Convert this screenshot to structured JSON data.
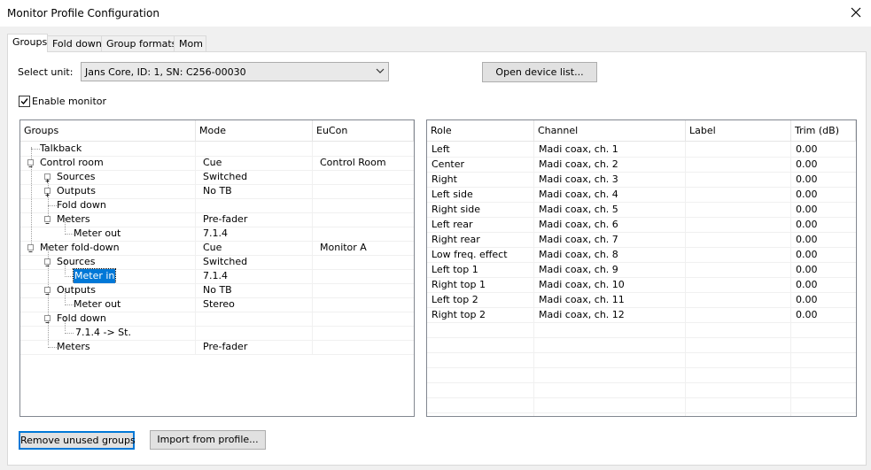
{
  "window": {
    "title": "Monitor Profile Configuration"
  },
  "tabs": [
    {
      "label": "Groups",
      "active": true
    },
    {
      "label": "Fold down",
      "active": false
    },
    {
      "label": "Group formats",
      "active": false
    },
    {
      "label": "Mom",
      "active": false
    }
  ],
  "select_unit": {
    "label": "Select unit:",
    "value": "Jans Core, ID: 1, SN: C256-00030"
  },
  "open_device_list": "Open device list...",
  "enable_monitor": {
    "label": "Enable monitor",
    "checked": true
  },
  "groups_table": {
    "headers": [
      "Groups",
      "Mode",
      "EuCon"
    ],
    "rows": [
      {
        "name": "Talkback",
        "mode": "",
        "eucon": ""
      },
      {
        "name": "Control room",
        "mode": "Cue",
        "eucon": "Control Room"
      },
      {
        "name": "Sources",
        "mode": "Switched",
        "eucon": ""
      },
      {
        "name": "Outputs",
        "mode": "No TB",
        "eucon": ""
      },
      {
        "name": "Fold down",
        "mode": "",
        "eucon": ""
      },
      {
        "name": "Meters",
        "mode": "Pre-fader",
        "eucon": ""
      },
      {
        "name": "Meter out",
        "mode": "7.1.4",
        "eucon": ""
      },
      {
        "name": "Meter fold-down",
        "mode": "Cue",
        "eucon": "Monitor A"
      },
      {
        "name": "Sources",
        "mode": "Switched",
        "eucon": ""
      },
      {
        "name": "Meter in",
        "mode": "7.1.4",
        "eucon": ""
      },
      {
        "name": "Outputs",
        "mode": "No TB",
        "eucon": ""
      },
      {
        "name": "Meter out",
        "mode": "Stereo",
        "eucon": ""
      },
      {
        "name": "Fold down",
        "mode": "",
        "eucon": ""
      },
      {
        "name": "7.1.4 -> St.",
        "mode": "",
        "eucon": ""
      },
      {
        "name": "Meters",
        "mode": "Pre-fader",
        "eucon": ""
      }
    ]
  },
  "channels_table": {
    "headers": [
      "Role",
      "Channel",
      "Label",
      "Trim (dB)"
    ],
    "rows": [
      {
        "role": "Left",
        "channel": "Madi coax, ch. 1",
        "label": "",
        "trim": "0.00"
      },
      {
        "role": "Center",
        "channel": "Madi coax, ch. 2",
        "label": "",
        "trim": "0.00"
      },
      {
        "role": "Right",
        "channel": "Madi coax, ch. 3",
        "label": "",
        "trim": "0.00"
      },
      {
        "role": "Left side",
        "channel": "Madi coax, ch. 4",
        "label": "",
        "trim": "0.00"
      },
      {
        "role": "Right side",
        "channel": "Madi coax, ch. 5",
        "label": "",
        "trim": "0.00"
      },
      {
        "role": "Left rear",
        "channel": "Madi coax, ch. 6",
        "label": "",
        "trim": "0.00"
      },
      {
        "role": "Right rear",
        "channel": "Madi coax, ch. 7",
        "label": "",
        "trim": "0.00"
      },
      {
        "role": "Low freq. effect",
        "channel": "Madi coax, ch. 8",
        "label": "",
        "trim": "0.00"
      },
      {
        "role": "Left top 1",
        "channel": "Madi coax, ch. 9",
        "label": "",
        "trim": "0.00"
      },
      {
        "role": "Right top 1",
        "channel": "Madi coax, ch. 10",
        "label": "",
        "trim": "0.00"
      },
      {
        "role": "Left top 2",
        "channel": "Madi coax, ch. 11",
        "label": "",
        "trim": "0.00"
      },
      {
        "role": "Right top 2",
        "channel": "Madi coax, ch. 12",
        "label": "",
        "trim": "0.00"
      }
    ]
  },
  "buttons": {
    "remove_unused": "Remove unused groups",
    "import_profile": "Import from profile..."
  }
}
